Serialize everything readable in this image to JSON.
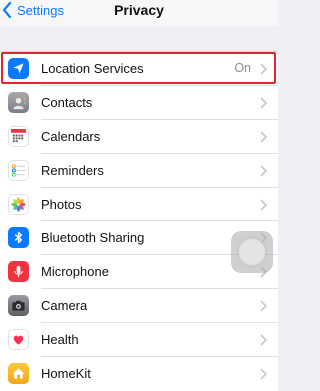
{
  "nav": {
    "back_label": "Settings",
    "title": "Privacy"
  },
  "rows": [
    {
      "label": "Location Services",
      "value": "On",
      "icon": "location-arrow-icon",
      "color": "#0a7aff"
    },
    {
      "label": "Contacts",
      "value": "",
      "icon": "contacts-icon",
      "color": "#8e8e93"
    },
    {
      "label": "Calendars",
      "value": "",
      "icon": "calendar-icon",
      "color": "#ffffff"
    },
    {
      "label": "Reminders",
      "value": "",
      "icon": "reminders-icon",
      "color": "#ffffff"
    },
    {
      "label": "Photos",
      "value": "",
      "icon": "photos-icon",
      "color": "#ffffff"
    },
    {
      "label": "Bluetooth Sharing",
      "value": "",
      "icon": "bluetooth-icon",
      "color": "#0a7aff"
    },
    {
      "label": "Microphone",
      "value": "",
      "icon": "microphone-icon",
      "color": "#ef3340"
    },
    {
      "label": "Camera",
      "value": "",
      "icon": "camera-icon",
      "color": "#6d6d72"
    },
    {
      "label": "Health",
      "value": "",
      "icon": "health-heart-icon",
      "color": "#ffffff"
    },
    {
      "label": "HomeKit",
      "value": "",
      "icon": "homekit-house-icon",
      "color": "#f7b01c"
    }
  ],
  "highlight_color": "#e2252b"
}
